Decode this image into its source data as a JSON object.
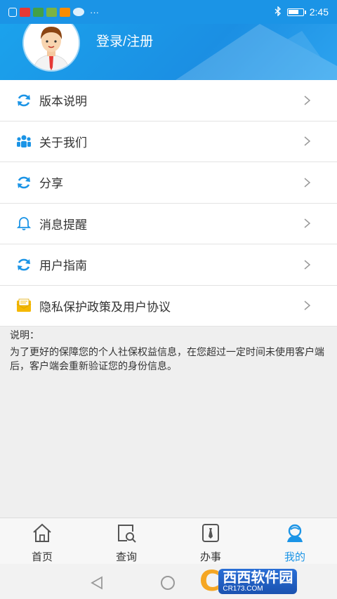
{
  "status_bar": {
    "time": "2:45",
    "notification_icons": [
      "alert-icon",
      "app-icon-red",
      "app-icon-green",
      "app-icon-green-2",
      "app-icon-orange",
      "wechat-icon"
    ],
    "more": "···"
  },
  "header": {
    "title": "登录/注册",
    "bg_color": "#1b94e6"
  },
  "menu": {
    "items": [
      {
        "label": "版本说明",
        "icon": "refresh-icon"
      },
      {
        "label": "关于我们",
        "icon": "group-icon"
      },
      {
        "label": "分享",
        "icon": "refresh-icon"
      },
      {
        "label": "消息提醒",
        "icon": "bell-icon"
      },
      {
        "label": "用户指南",
        "icon": "refresh-icon"
      },
      {
        "label": "隐私保护政策及用户协议",
        "icon": "envelope-icon"
      }
    ]
  },
  "note": {
    "title": "说明：",
    "body": "为了更好的保障您的个人社保权益信息，在您超过一定时间未使用客户端后，客户端会重新验证您的身份信息。"
  },
  "tabbar": {
    "tabs": [
      {
        "label": "首页",
        "icon": "home-icon"
      },
      {
        "label": "查询",
        "icon": "search-icon"
      },
      {
        "label": "办事",
        "icon": "tie-icon"
      },
      {
        "label": "我的",
        "icon": "user-icon",
        "active": true
      }
    ]
  },
  "watermark": {
    "brand": "西西",
    "brand2": "软件园",
    "site": "CR173.COM"
  },
  "colors": {
    "accent": "#1b94e6",
    "envelope": "#f5b800"
  }
}
